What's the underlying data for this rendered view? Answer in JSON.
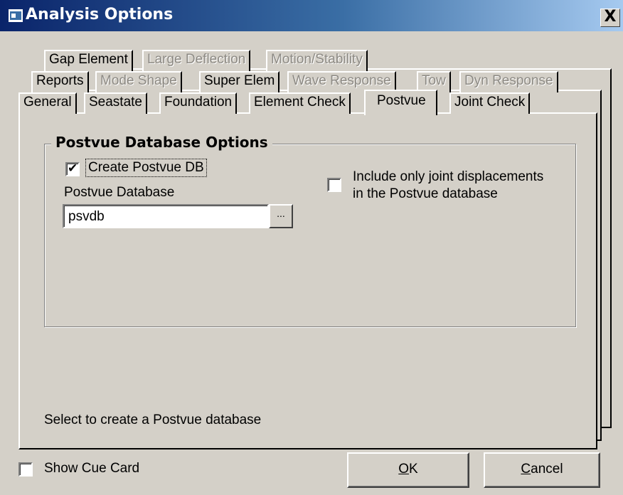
{
  "window": {
    "title": "Analysis Options",
    "close_label": "X"
  },
  "tabs": {
    "row1": [
      {
        "label": "Gap Element",
        "enabled": true
      },
      {
        "label": "Large Deflection",
        "enabled": false
      },
      {
        "label": "Motion/Stability",
        "enabled": false
      }
    ],
    "row2": [
      {
        "label": "Reports",
        "enabled": true
      },
      {
        "label": "Mode Shape",
        "enabled": false
      },
      {
        "label": "Super Elem",
        "enabled": true
      },
      {
        "label": "Wave Response",
        "enabled": false
      },
      {
        "label": "Tow",
        "enabled": false
      },
      {
        "label": "Dyn Response",
        "enabled": false
      }
    ],
    "row3": [
      {
        "label": "General",
        "enabled": true
      },
      {
        "label": "Seastate",
        "enabled": true
      },
      {
        "label": "Foundation",
        "enabled": true
      },
      {
        "label": "Element Check",
        "enabled": true
      },
      {
        "label": "Postvue",
        "enabled": true,
        "active": true
      },
      {
        "label": "Joint Check",
        "enabled": true
      }
    ]
  },
  "postvue": {
    "group_title": "Postvue Database Options",
    "create_db": {
      "label": "Create Postvue DB",
      "checked": true
    },
    "database_label": "Postvue Database",
    "database_value": "psvdb",
    "browse_label": "...",
    "joint_only": {
      "label_line1": "Include only joint displacements",
      "label_line2": "in the Postvue database",
      "checked": false
    },
    "status_text": "Select to create a Postvue database"
  },
  "footer": {
    "show_cue_card": {
      "label": "Show Cue Card",
      "checked": false
    },
    "ok_label": "OK",
    "cancel_label": "Cancel"
  }
}
